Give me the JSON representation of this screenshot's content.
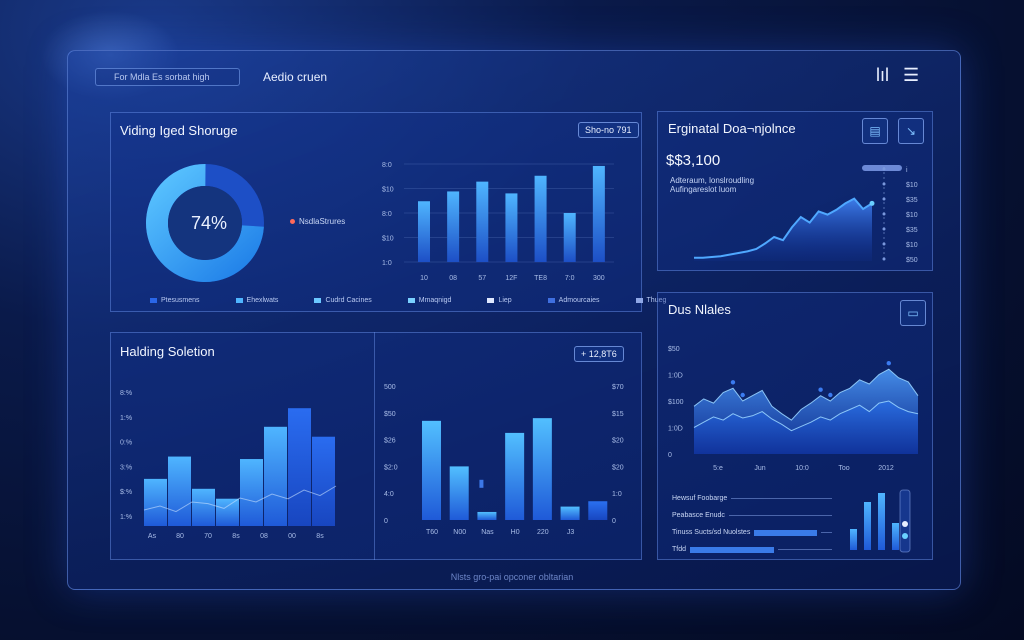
{
  "header": {
    "search_text": "For Mdla Es sorbat high",
    "title": "Aedio cruen",
    "icons": [
      "chart-icon",
      "menu-icon"
    ],
    "chart_icon_text": "lıl",
    "menu_icon_text": "☰"
  },
  "storage_panel": {
    "title": "Viding Iged Shoruge",
    "chip": "Sho-no 791",
    "donut_label": "74%",
    "donut_value": 0.74,
    "side_label": "NsdlaStrures",
    "legend": [
      {
        "label": "Ptesusmens",
        "color": "#2a66e8"
      },
      {
        "label": "Ehexlwats",
        "color": "#4fb5ff"
      },
      {
        "label": "Cudrd Cacines",
        "color": "#6bc8ff"
      },
      {
        "label": "Mmaqnigd",
        "color": "#7ad1ff"
      },
      {
        "label": "Liep",
        "color": "#e0e8ff"
      },
      {
        "label": "Admourcaies",
        "color": "#3f6fe0"
      },
      {
        "label": "Thueg",
        "color": "#8fa7e6"
      }
    ],
    "bar_y_ticks": [
      "8:0",
      "$10",
      "8:0",
      "$10",
      "1:0"
    ],
    "bar_x_ticks": [
      "10",
      "08",
      "57",
      "12F",
      "TE8",
      "7:0",
      "300"
    ],
    "bar_values": [
      0.62,
      0.72,
      0.82,
      0.7,
      0.88,
      0.5,
      0.98
    ]
  },
  "engagement_panel": {
    "title": "Erginatal Doa¬njolnce",
    "kpi": "$$3,100",
    "kpi_sub": "Adteraum, lonslroudling Aufingareslot luom",
    "y_ticks": [
      "i",
      "$10",
      "$35",
      "$10",
      "$35",
      "$10",
      "$50"
    ],
    "line_values": [
      0.04,
      0.04,
      0.05,
      0.06,
      0.08,
      0.1,
      0.12,
      0.15,
      0.22,
      0.3,
      0.26,
      0.42,
      0.55,
      0.48,
      0.62,
      0.58,
      0.64,
      0.72,
      0.78,
      0.65,
      0.72
    ]
  },
  "holding_panel": {
    "title": "Halding Soletion",
    "y_ticks": [
      "8:%",
      "1:%",
      "0:%",
      "3:%",
      "$:%",
      "1:%"
    ],
    "x_ticks": [
      "As",
      "80",
      "70",
      "8s",
      "08",
      "00",
      "8s"
    ],
    "bar_values": [
      0.38,
      0.56,
      0.3,
      0.22,
      0.54,
      0.8,
      0.95,
      0.72
    ],
    "line_values": [
      0.2,
      0.25,
      0.18,
      0.3,
      0.28,
      0.22,
      0.35,
      0.3,
      0.4,
      0.34,
      0.45,
      0.38,
      0.5
    ]
  },
  "middle_bar_panel": {
    "chip": "+ 12,8T6",
    "y_ticks": [
      "500",
      "$50",
      "$26",
      "$2:0",
      "4:0",
      "0"
    ],
    "y2_ticks": [
      "$70",
      "$15",
      "$20",
      "$20",
      "1:0",
      "0"
    ],
    "x_ticks": [
      "T60",
      "N00",
      "Nas",
      "H0",
      "220",
      "J3"
    ],
    "bar_values": [
      0.74,
      0.4,
      0.06,
      0.65,
      0.76,
      0.1,
      0.14
    ]
  },
  "sales_panel": {
    "title": "Dus Nlales",
    "y_ticks": [
      "$50",
      "1:0D",
      "$100",
      "1:0D",
      "0"
    ],
    "x_ticks": [
      "5:e",
      "Jun",
      "10:0",
      "Too",
      "2012"
    ],
    "area_values": [
      0.45,
      0.52,
      0.48,
      0.58,
      0.62,
      0.5,
      0.55,
      0.6,
      0.45,
      0.38,
      0.32,
      0.42,
      0.48,
      0.55,
      0.5,
      0.58,
      0.62,
      0.7,
      0.66,
      0.75,
      0.8,
      0.72,
      0.68,
      0.55
    ],
    "area2_values": [
      0.25,
      0.3,
      0.35,
      0.32,
      0.38,
      0.34,
      0.36,
      0.4,
      0.33,
      0.28,
      0.22,
      0.26,
      0.3,
      0.35,
      0.32,
      0.38,
      0.42,
      0.46,
      0.4,
      0.48,
      0.5,
      0.44,
      0.4,
      0.38
    ],
    "rows": [
      {
        "label": "Hewsuf Foobarge",
        "fill": 0
      },
      {
        "label": "Peabasce Enudc",
        "fill": 0
      },
      {
        "label": "Tinuss Sucts/sd Nuolstes",
        "fill": 0.45
      },
      {
        "label": "Tfdd",
        "fill": 0.6
      }
    ],
    "mini_bar_values": [
      0.35,
      0.8,
      0.95,
      0.45,
      0.5
    ]
  },
  "footer": {
    "text": "Nlsts gro-pai opconer obltarian"
  }
}
